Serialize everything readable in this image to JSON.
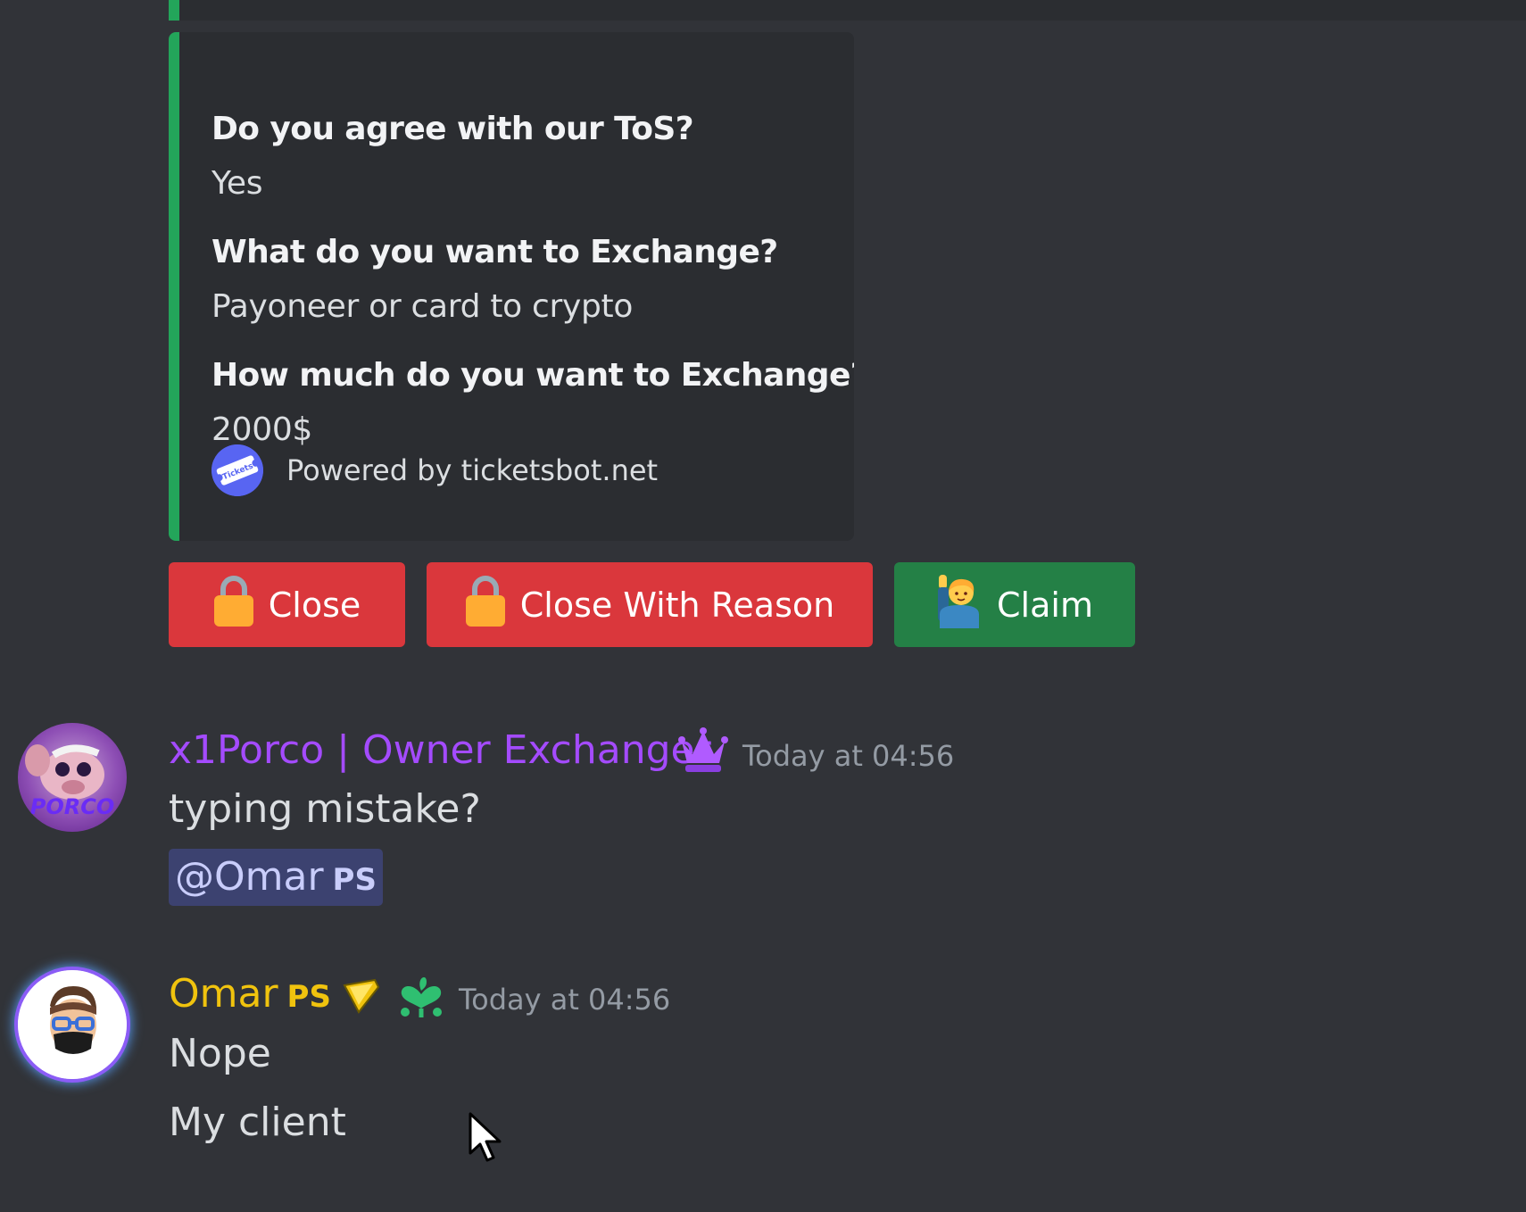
{
  "embed": {
    "fields": [
      {
        "name": "Do you agree with our ToS?",
        "value": "Yes"
      },
      {
        "name": "What do you want to Exchange?",
        "value": "Payoneer or card to crypto"
      },
      {
        "name": "How much do you want to Exchange?",
        "value": "2000$"
      }
    ],
    "footer": {
      "text": "Powered by ticketsbot.net",
      "icon_text": "Tickets"
    },
    "accent_color": "#23a55a"
  },
  "buttons": [
    {
      "label": "Close",
      "icon": "lock-icon",
      "color": "#da373c"
    },
    {
      "label": "Close With Reason",
      "icon": "lock-icon",
      "color": "#da373c"
    },
    {
      "label": "Claim",
      "icon": "raising-hand-person-icon",
      "color": "#248046"
    }
  ],
  "messages": [
    {
      "author": "x1Porco | Owner Exchanger",
      "author_color": "#a44bff",
      "badge_icon": "crown-icon",
      "timestamp": "Today at 04:56",
      "avatar_text": "PORCO",
      "lines": [
        "typing mistake?"
      ],
      "mention": {
        "name": "@Omar",
        "tag": "PS"
      }
    },
    {
      "author": "Omar",
      "author_tag": "PS",
      "author_color": "#f0c30e",
      "badge_icons": [
        "gem-icon",
        "clover-heart-icon"
      ],
      "timestamp": "Today at 04:56",
      "lines": [
        "Nope",
        "My client"
      ]
    }
  ]
}
